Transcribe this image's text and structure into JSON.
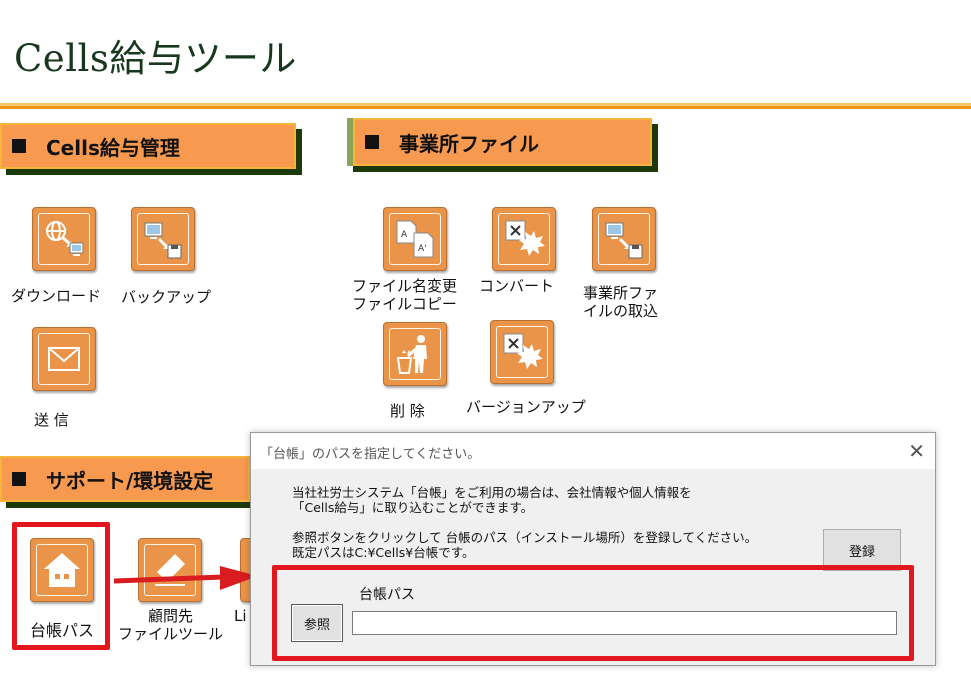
{
  "app": {
    "title": "Cells給与ツール"
  },
  "sections": {
    "salary": "Cells給与管理",
    "office": "事業所ファイル",
    "support": "サポート/環境設定"
  },
  "tools": {
    "download": "ダウンロード",
    "backup": "バックアップ",
    "send": "送 信",
    "rename_line1": "ファイル名変更",
    "rename_line2": "ファイルコピー",
    "convert": "コンバート",
    "import_line1": "事業所ファ",
    "import_line2": "イルの取込",
    "delete": "削 除",
    "version_up": "バージョンアップ",
    "ledger_path": "台帳パス",
    "advisor_line1": "顧問先",
    "advisor_line2": "ファイルツール",
    "partial_label": "Li"
  },
  "dialog": {
    "title": "「台帳」のパスを指定してください。",
    "close": "✕",
    "msg1_line1": "当社社労士システム「台帳」をご利用の場合は、会社情報や個人情報を",
    "msg1_line2": "「Cells給与」に取り込むことができます。",
    "msg2_line1": "参照ボタンをクリックして 台帳のパス（インストール場所）を登録してください。",
    "msg2_line2": "既定パスはC:¥Cells¥台帳です。",
    "register_label": "登録",
    "browse_label": "参照",
    "path_label": "台帳パス",
    "path_value": ""
  },
  "colors": {
    "accent_orange": "#f79a4f",
    "icon_orange": "#e99448",
    "title_green": "#17381d",
    "highlight_red": "#e4161d"
  }
}
